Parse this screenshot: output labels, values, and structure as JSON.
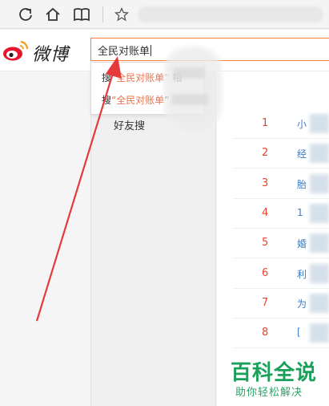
{
  "search": {
    "query": "全民对账单"
  },
  "brand": {
    "name": "微博"
  },
  "dropdown": {
    "rows": [
      {
        "prefix": "搜",
        "term": "“全民对账单”",
        "suffix": "相"
      },
      {
        "prefix": "搜",
        "term": "“全民对账单",
        "suffix": "”"
      }
    ]
  },
  "sidebar": {
    "friend_search": "好友搜"
  },
  "ranking": {
    "items": [
      {
        "rank": "1",
        "text": "小"
      },
      {
        "rank": "2",
        "text": "经"
      },
      {
        "rank": "3",
        "text": "胎"
      },
      {
        "rank": "4",
        "text": "1"
      },
      {
        "rank": "5",
        "text": "婚"
      },
      {
        "rank": "6",
        "text": "利"
      },
      {
        "rank": "7",
        "text": "为"
      },
      {
        "rank": "8",
        "text": "["
      }
    ]
  },
  "watermark": {
    "title": "百科全说",
    "subtitle": "助你轻松解决"
  },
  "colors": {
    "accent": "#fa7d3c",
    "rank_red": "#e8442e",
    "arrow": "#e63a3a",
    "watermark_green": "#1aa05a"
  }
}
